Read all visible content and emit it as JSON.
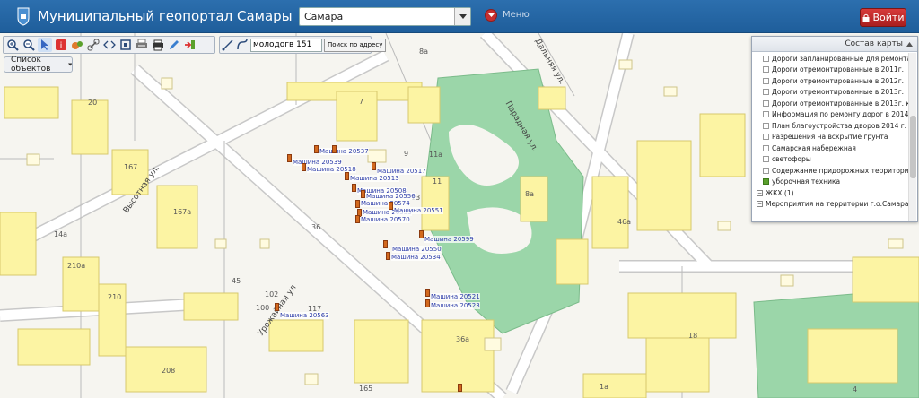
{
  "header": {
    "title": "Муниципальный геопортал Самары",
    "city_select_value": "Самара",
    "menu_label": "Меню",
    "login_label": "Войти"
  },
  "toolbar": {
    "icons": [
      "zoom-in-icon",
      "zoom-out-icon",
      "pointer-icon",
      "info-icon",
      "layers-icon",
      "link-icon",
      "code-icon",
      "fullscreen-icon",
      "print-settings-icon",
      "print-icon",
      "edit-icon",
      "exit-icon"
    ],
    "search_value": "молодогв 151",
    "search_button_label": "Поиск по адресу",
    "objects_button_label": "Список объектов"
  },
  "layers_panel": {
    "title": "Состав карты",
    "items": [
      {
        "label": "Дороги запланированные для ремонта в 2014г",
        "checked": false
      },
      {
        "label": "Дороги отремонтированные в 2011г.",
        "checked": false
      },
      {
        "label": "Дороги отремонтированные в 2012г.",
        "checked": false
      },
      {
        "label": "Дороги отремонтированные в 2013г.",
        "checked": false
      },
      {
        "label": "Дороги отремонтированные в 2013г. картами",
        "checked": false
      },
      {
        "label": "Информация по ремонту дорог  в 2014 году",
        "checked": false
      },
      {
        "label": "План благоустройства дворов 2014 г.",
        "checked": false
      },
      {
        "label": "Разрешения на вскрытие грунта",
        "checked": false
      },
      {
        "label": "Самарская набережная",
        "checked": false
      },
      {
        "label": "светофоры",
        "checked": false
      },
      {
        "label": "Содержание придорожных территорий города",
        "checked": false
      },
      {
        "label": "уборочная техника",
        "checked": true
      }
    ],
    "groups": [
      {
        "label": "ЖКХ (1)"
      },
      {
        "label": "Мероприятия на территории г.о.Самара (5"
      }
    ]
  },
  "map": {
    "streets": [
      "Высотная ул.",
      "Дальняя ул.",
      "Парадная ул.",
      "Урожайная ул"
    ],
    "building_numbers": [
      "20",
      "167",
      "167a",
      "14a",
      "210a",
      "210",
      "208",
      "165",
      "9",
      "7",
      "8a",
      "11a",
      "11",
      "13",
      "36",
      "45",
      "102",
      "100",
      "117",
      "36a",
      "8a",
      "46a",
      "18",
      "1a",
      "4"
    ],
    "vehicle_labels": [
      "Машина 20539",
      "Машина 20537",
      "Машина 20518",
      "Машина 20517",
      "Машина 20513",
      "Машина 20508",
      "Машина 20556",
      "Машина 20574",
      "Машина 20553",
      "Машина 20551",
      "Машина 20570",
      "Машина 20599",
      "Машина 20550",
      "Машина 20534",
      "Машина 20521",
      "Машина 20523",
      "Машина 20563"
    ]
  },
  "colors": {
    "header_bg": "#2c6fae",
    "building_yellow": "#fcf4a3",
    "park_green": "#9bd6a9",
    "marker_orange": "#d2691e",
    "login_red": "#c62f2f"
  }
}
